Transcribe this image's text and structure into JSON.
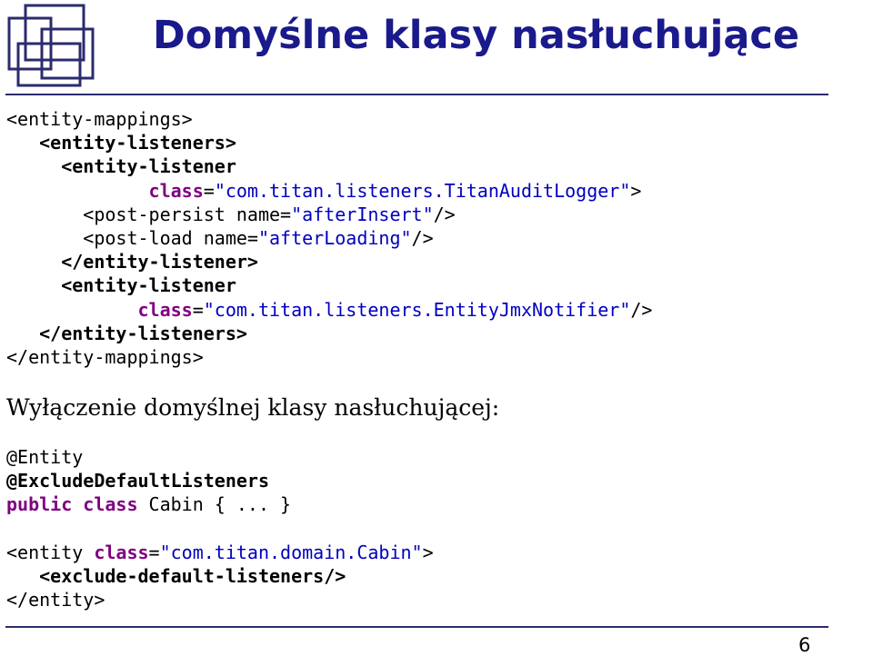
{
  "title": "Domyślne klasy nasłuchujące",
  "page_number": "6",
  "colors": {
    "title": "#1a1a8c",
    "rule": "#2b2b6e",
    "logo": "#2b2b6e",
    "keyword": "#800080",
    "value": "#0000c0",
    "text": "#000000"
  },
  "xml_block": [
    {
      "indent": "",
      "parts": [
        {
          "text": "<entity-mappings>",
          "role": "plain"
        }
      ]
    },
    {
      "indent": "   ",
      "parts": [
        {
          "text": "<entity-listeners>",
          "role": "bold"
        }
      ]
    },
    {
      "indent": "     ",
      "parts": [
        {
          "text": "<entity-listener",
          "role": "bold"
        }
      ]
    },
    {
      "indent": "             ",
      "parts": [
        {
          "text": "class",
          "role": "keyword"
        },
        {
          "text": "=",
          "role": "plain"
        },
        {
          "text": "\"com.titan.listeners.TitanAuditLogger\"",
          "role": "value"
        },
        {
          "text": ">",
          "role": "plain"
        }
      ]
    },
    {
      "indent": "       ",
      "parts": [
        {
          "text": "<post-persist name=",
          "role": "plain"
        },
        {
          "text": "\"afterInsert\"",
          "role": "value"
        },
        {
          "text": "/>",
          "role": "plain"
        }
      ]
    },
    {
      "indent": "       ",
      "parts": [
        {
          "text": "<post-load name=",
          "role": "plain"
        },
        {
          "text": "\"afterLoading\"",
          "role": "value"
        },
        {
          "text": "/>",
          "role": "plain"
        }
      ]
    },
    {
      "indent": "     ",
      "parts": [
        {
          "text": "</entity-listener>",
          "role": "bold"
        }
      ]
    },
    {
      "indent": "     ",
      "parts": [
        {
          "text": "<entity-listener",
          "role": "bold"
        }
      ]
    },
    {
      "indent": "            ",
      "parts": [
        {
          "text": "class",
          "role": "keyword"
        },
        {
          "text": "=",
          "role": "plain"
        },
        {
          "text": "\"com.titan.listeners.EntityJmxNotifier\"",
          "role": "value"
        },
        {
          "text": "/>",
          "role": "plain"
        }
      ]
    },
    {
      "indent": "   ",
      "parts": [
        {
          "text": "</entity-listeners>",
          "role": "bold"
        }
      ]
    },
    {
      "indent": "",
      "parts": [
        {
          "text": "</entity-mappings>",
          "role": "plain"
        }
      ]
    }
  ],
  "section_heading": "Wyłączenie domyślnej klasy nasłuchującej:",
  "annotation_block": [
    {
      "indent": "",
      "parts": [
        {
          "text": "@Entity",
          "role": "plain"
        }
      ]
    },
    {
      "indent": "",
      "parts": [
        {
          "text": "@ExcludeDefaultListeners",
          "role": "bold"
        }
      ]
    },
    {
      "indent": "",
      "parts": [
        {
          "text": "public class",
          "role": "keyword"
        },
        {
          "text": " Cabin { ... }",
          "role": "plain"
        }
      ]
    }
  ],
  "xml_block_2": [
    {
      "indent": "",
      "parts": [
        {
          "text": "<entity ",
          "role": "plain"
        },
        {
          "text": "class",
          "role": "keyword"
        },
        {
          "text": "=",
          "role": "plain"
        },
        {
          "text": "\"com.titan.domain.Cabin\"",
          "role": "value"
        },
        {
          "text": ">",
          "role": "plain"
        }
      ]
    },
    {
      "indent": "   ",
      "parts": [
        {
          "text": "<exclude-default-listeners/>",
          "role": "bold"
        }
      ]
    },
    {
      "indent": "",
      "parts": [
        {
          "text": "</entity>",
          "role": "plain"
        }
      ]
    }
  ]
}
